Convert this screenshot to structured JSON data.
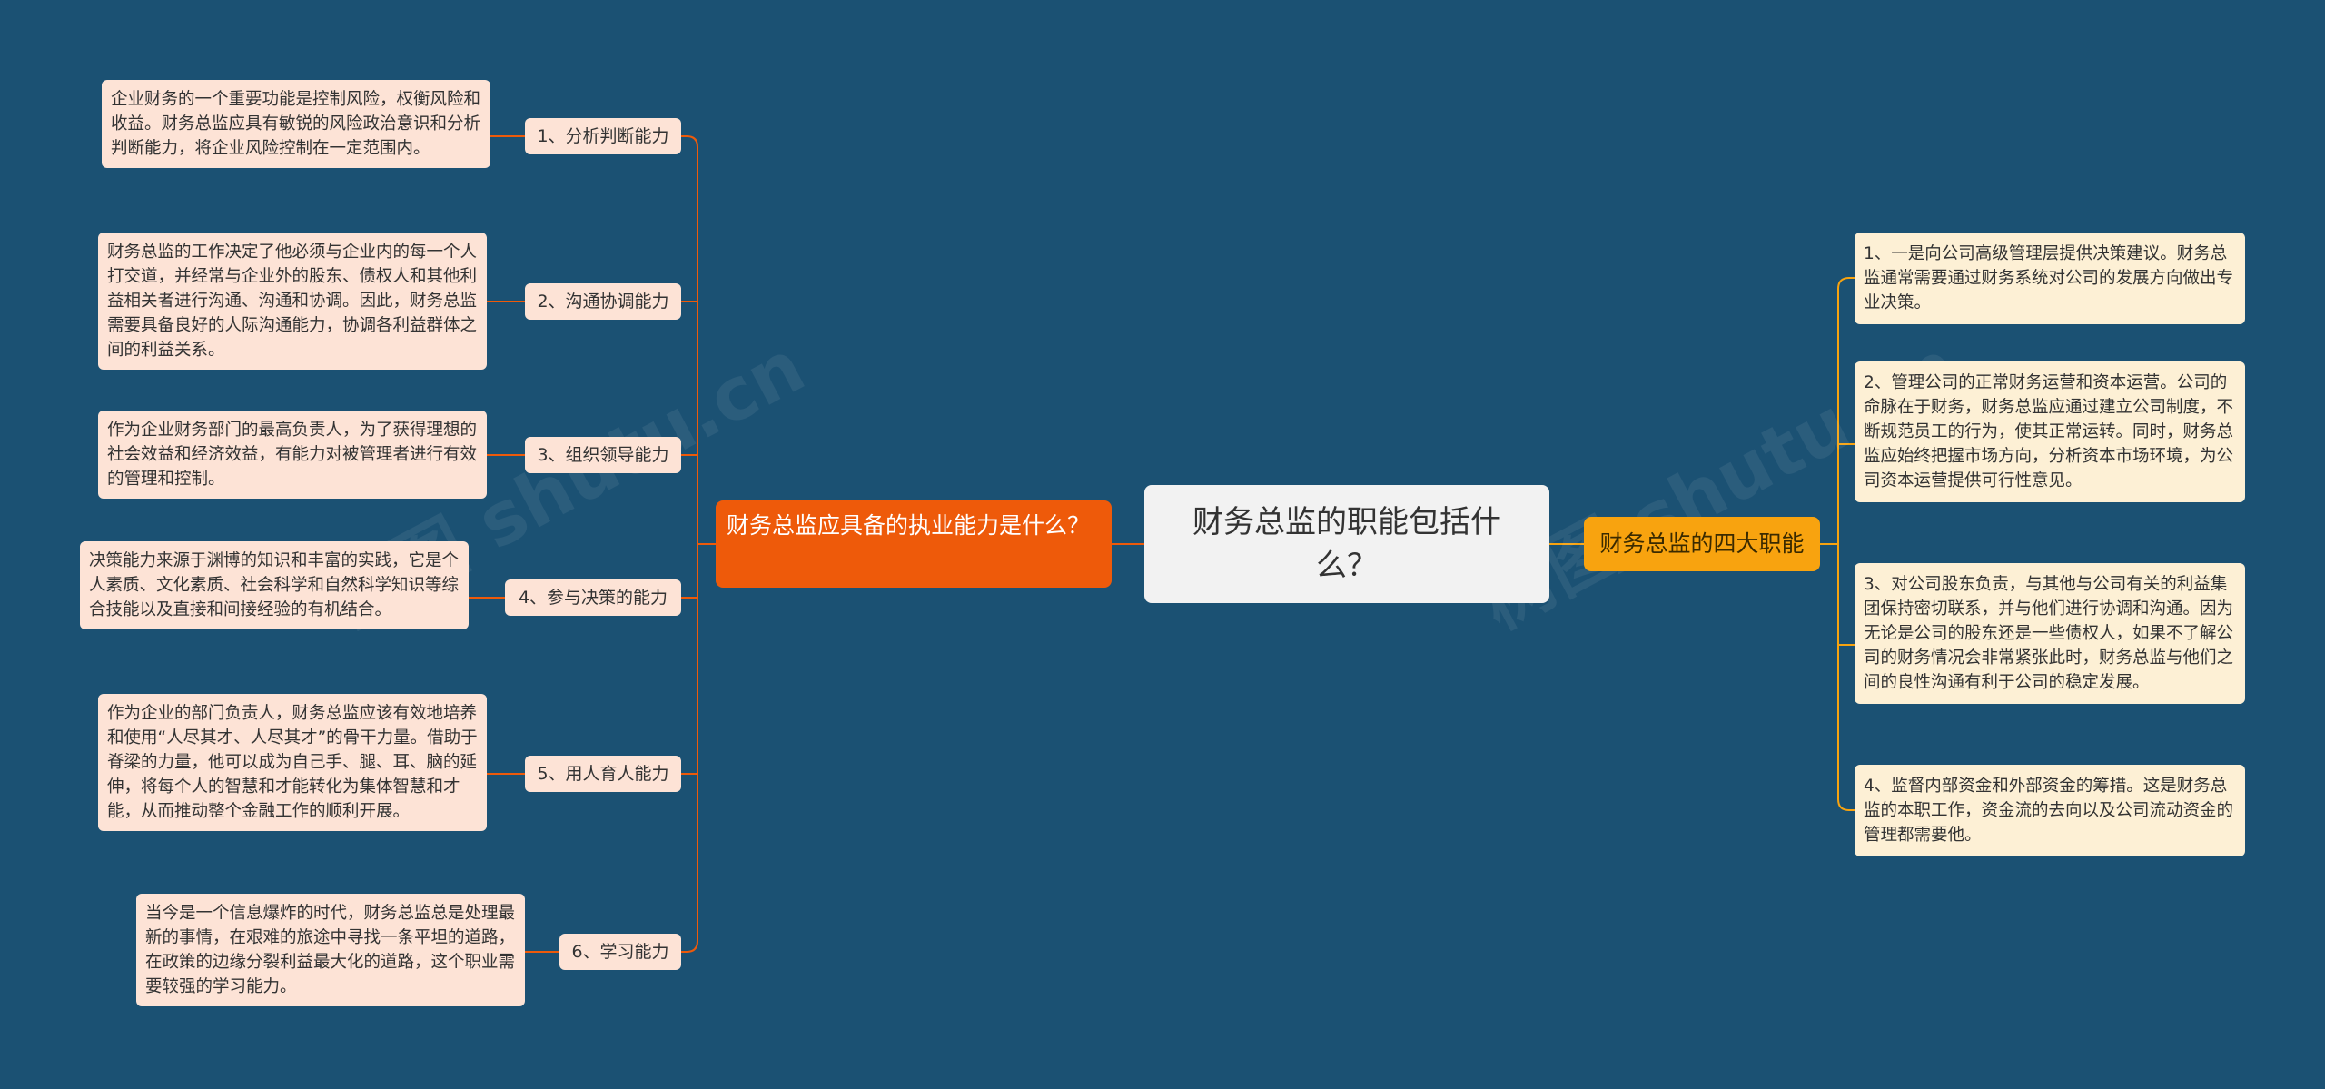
{
  "center": {
    "title": "财务总监的职能包括什么？"
  },
  "left_branch": {
    "title": "财务总监应具备的执业能力是什么？",
    "items": [
      {
        "label": "1、分析判断能力",
        "desc": "企业财务的一个重要功能是控制风险，权衡风险和收益。财务总监应具有敏锐的风险政治意识和分析判断能力，将企业风险控制在一定范围内。"
      },
      {
        "label": "2、沟通协调能力",
        "desc": "财务总监的工作决定了他必须与企业内的每一个人打交道，并经常与企业外的股东、债权人和其他利益相关者进行沟通、沟通和协调。因此，财务总监需要具备良好的人际沟通能力，协调各利益群体之间的利益关系。"
      },
      {
        "label": "3、组织领导能力",
        "desc": "作为企业财务部门的最高负责人，为了获得理想的社会效益和经济效益，有能力对被管理者进行有效的管理和控制。"
      },
      {
        "label": "4、参与决策的能力",
        "desc": "决策能力来源于渊博的知识和丰富的实践，它是个人素质、文化素质、社会科学和自然科学知识等综合技能以及直接和间接经验的有机结合。"
      },
      {
        "label": "5、用人育人能力",
        "desc": "作为企业的部门负责人，财务总监应该有效地培养和使用“人尽其才、人尽其才”的骨干力量。借助于脊梁的力量，他可以成为自己手、腿、耳、脑的延伸，将每个人的智慧和才能转化为集体智慧和才能，从而推动整个金融工作的顺利开展。"
      },
      {
        "label": "6、学习能力",
        "desc": "当今是一个信息爆炸的时代，财务总监总是处理最新的事情，在艰难的旅途中寻找一条平坦的道路，在政策的边缘分裂利益最大化的道路，这个职业需要较强的学习能力。"
      }
    ]
  },
  "right_branch": {
    "title": "财务总监的四大职能",
    "items": [
      {
        "desc": "1、一是向公司高级管理层提供决策建议。财务总监通常需要通过财务系统对公司的发展方向做出专业决策。"
      },
      {
        "desc": "2、管理公司的正常财务运营和资本运营。公司的命脉在于财务，财务总监应通过建立公司制度，不断规范员工的行为，使其正常运转。同时，财务总监应始终把握市场方向，分析资本市场环境，为公司资本运营提供可行性意见。"
      },
      {
        "desc": "3、对公司股东负责，与其他与公司有关的利益集团保持密切联系，并与他们进行协调和沟通。因为无论是公司的股东还是一些债权人，如果不了解公司的财务情况会非常紧张此时，财务总监与他们之间的良性沟通有利于公司的稳定发展。"
      },
      {
        "desc": "4、监督内部资金和外部资金的筹措。这是财务总监的本职工作，资金流的去向以及公司流动资金的管理都需要他。"
      }
    ]
  },
  "watermark": {
    "text": "树图 shutu.cn"
  },
  "colors": {
    "background": "#1b5173",
    "center_bg": "#f2f2f2",
    "left_branch_bg": "#ee5a0a",
    "right_branch_bg": "#f8a30f",
    "left_leaf_bg": "#fde3d6",
    "right_leaf_bg": "#fdf0d5",
    "left_line": "#ee5a0a",
    "right_line": "#f8a30f"
  }
}
